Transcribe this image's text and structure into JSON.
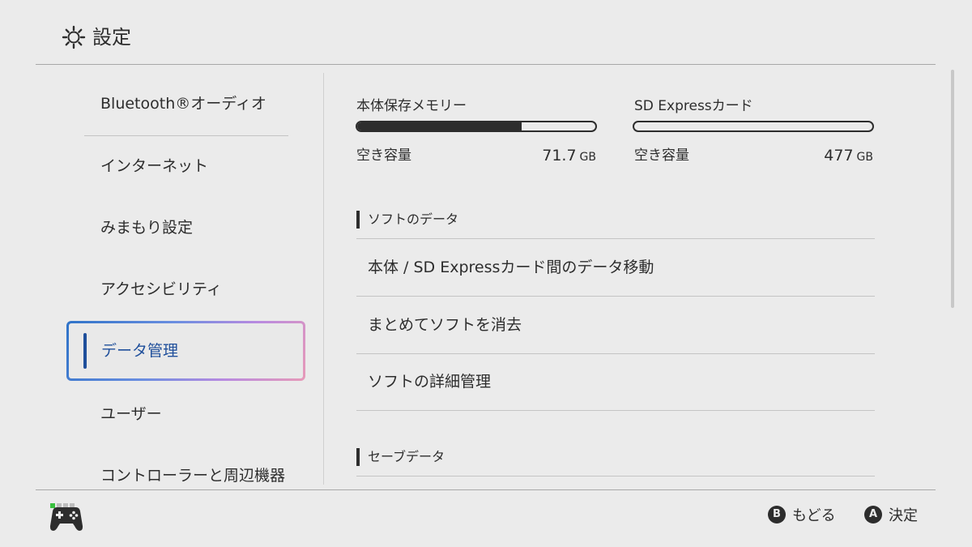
{
  "header": {
    "title": "設定",
    "icon": "gear-icon"
  },
  "sidebar": {
    "items": [
      {
        "label": "Bluetooth®オーディオ"
      },
      {
        "label": "インターネット"
      },
      {
        "label": "みまもり設定"
      },
      {
        "label": "アクセシビリティ"
      },
      {
        "label": "データ管理",
        "selected": true
      },
      {
        "label": "ユーザー"
      },
      {
        "label": "コントローラーと周辺機器"
      }
    ]
  },
  "storage": {
    "internal": {
      "label": "本体保存メモリー",
      "used_fraction": 0.69,
      "free_label": "空き容量",
      "free_value": "71.7",
      "free_unit": "GB"
    },
    "sd": {
      "label": "SD Expressカード",
      "used_fraction": 0.0,
      "free_label": "空き容量",
      "free_value": "477",
      "free_unit": "GB"
    }
  },
  "sections": {
    "software": {
      "title": "ソフトのデータ",
      "rows": [
        "本体 / SD Expressカード間のデータ移動",
        "まとめてソフトを消去",
        "ソフトの詳細管理"
      ]
    },
    "save": {
      "title": "セーブデータ"
    }
  },
  "footer": {
    "controller_icon": "controller-icon",
    "player_leds": [
      true,
      false,
      false,
      false
    ],
    "back": {
      "button": "B",
      "label": "もどる"
    },
    "ok": {
      "button": "A",
      "label": "決定"
    }
  },
  "colors": {
    "background": "#ebebeb",
    "text": "#2d2d2d",
    "selected_text": "#1f4f9b",
    "led_on": "#39c13f"
  }
}
